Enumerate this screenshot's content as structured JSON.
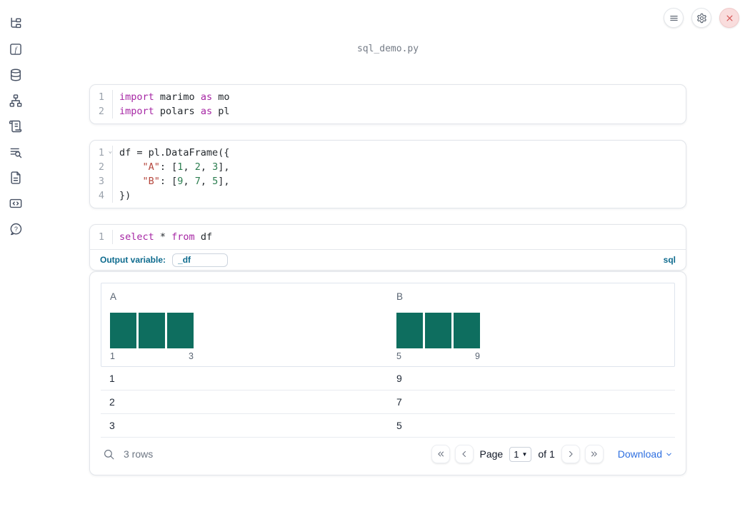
{
  "window": {
    "title": "sql_demo.py"
  },
  "topbar": {
    "buttons": [
      {
        "icon": "menu"
      },
      {
        "icon": "settings-gear"
      },
      {
        "icon": "close-x"
      }
    ]
  },
  "sidebar": {
    "items": [
      {
        "icon": "file-explorer-tree"
      },
      {
        "icon": "variables-function"
      },
      {
        "icon": "datasources-database"
      },
      {
        "icon": "dependency-graph"
      },
      {
        "icon": "logs-scroll"
      },
      {
        "icon": "tracing-list-search"
      },
      {
        "icon": "documentation-file"
      },
      {
        "icon": "snippets-code"
      },
      {
        "icon": "help-question"
      }
    ]
  },
  "cells": [
    {
      "lines": [
        {
          "number": "1",
          "tokens": [
            "import",
            " marimo ",
            "as",
            " mo"
          ]
        },
        {
          "number": "2",
          "tokens": [
            "import",
            " polars ",
            "as",
            " pl"
          ]
        }
      ]
    },
    {
      "lines": [
        {
          "number": "1",
          "fold": "⌄",
          "tokens": [
            "df = pl.DataFrame({"
          ]
        },
        {
          "number": "2",
          "tokens": [
            "    ",
            "\"A\"",
            ": [",
            "1",
            ", ",
            "2",
            ", ",
            "3",
            "],"
          ]
        },
        {
          "number": "3",
          "tokens": [
            "    ",
            "\"B\"",
            ": [",
            "9",
            ", ",
            "7",
            ", ",
            "5",
            "],"
          ]
        },
        {
          "number": "4",
          "tokens": [
            "})"
          ]
        }
      ]
    },
    {
      "lines": [
        {
          "number": "1",
          "tokens": [
            "select",
            " * ",
            "from",
            " df"
          ]
        }
      ],
      "footer": {
        "label": "Output variable:",
        "value": "_df",
        "language": "sql"
      }
    }
  ],
  "table": {
    "columns": [
      {
        "name": "A",
        "hist_values": [
          1,
          1,
          1
        ],
        "hist_labels": [
          "1",
          "3"
        ]
      },
      {
        "name": "B",
        "hist_values": [
          1,
          1,
          1
        ],
        "hist_labels": [
          "5",
          "9"
        ]
      }
    ],
    "rows": [
      [
        "1",
        "9"
      ],
      [
        "2",
        "7"
      ],
      [
        "3",
        "5"
      ]
    ],
    "footer": {
      "row_count": "3 rows",
      "page_label": "Page",
      "page_value": "1",
      "of_label": "of 1",
      "download_label": "Download"
    }
  },
  "colors": {
    "histogram_bar": "#0e6e5f",
    "sql_accent": "#0e6b8e",
    "download_link": "#2e6fe0",
    "close_button": "#d45353",
    "keyword": "#a626a4",
    "string": "#b5473d",
    "number": "#2b7d4f"
  }
}
